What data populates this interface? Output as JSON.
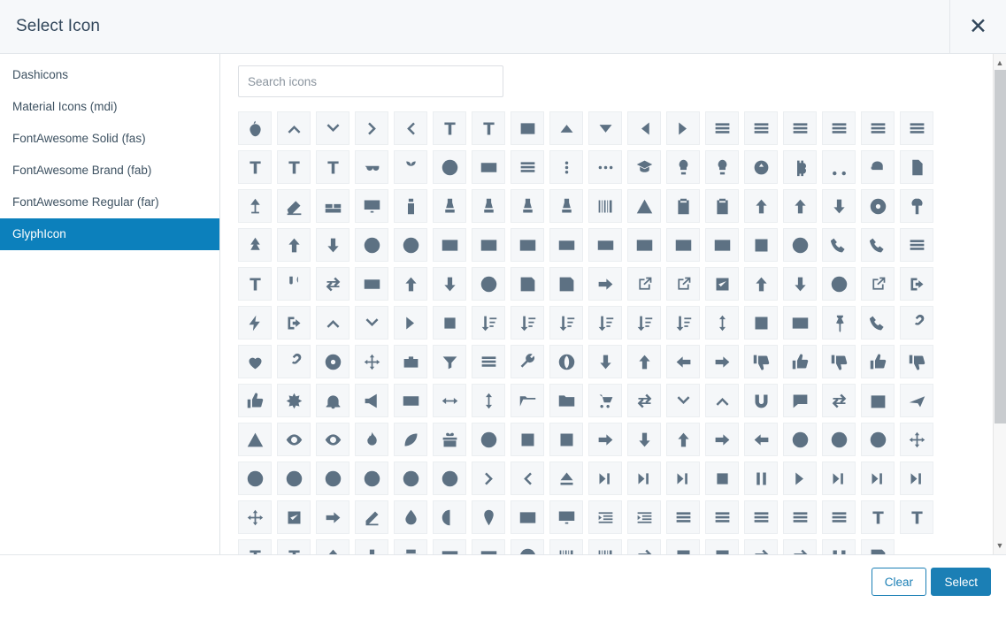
{
  "dialog": {
    "title": "Select Icon",
    "close_label": "✕"
  },
  "colors": {
    "accent": "#1b7fb5",
    "sidebar_active_bg": "#0c80bc",
    "header_bg": "#f6f8fa",
    "tile_bg": "#f5f7f9",
    "icon_fill": "#5d7183",
    "text": "#32475b"
  },
  "sidebar": {
    "items": [
      {
        "label": "Dashicons",
        "active": false
      },
      {
        "label": "Material Icons (mdi)",
        "active": false
      },
      {
        "label": "FontAwesome Solid (fas)",
        "active": false
      },
      {
        "label": "FontAwesome Brand (fab)",
        "active": false
      },
      {
        "label": "FontAwesome Regular (far)",
        "active": false
      },
      {
        "label": "GlyphIcon",
        "active": true
      }
    ]
  },
  "search": {
    "placeholder": "Search icons",
    "value": ""
  },
  "grid": {
    "columns": 18,
    "icons": [
      {
        "name": "apple-icon",
        "glyph": "🍎"
      },
      {
        "name": "chevron-up-icon",
        "glyph": "︿"
      },
      {
        "name": "chevron-down-icon",
        "glyph": "﹀"
      },
      {
        "name": "chevron-right-icon",
        "glyph": "›"
      },
      {
        "name": "chevron-left-icon",
        "glyph": "‹"
      },
      {
        "name": "subscript-icon",
        "glyph": "T₂"
      },
      {
        "name": "superscript-icon",
        "glyph": "T²"
      },
      {
        "name": "terminal-icon",
        "glyph": "≥_"
      },
      {
        "name": "triangle-up-icon",
        "glyph": "▲"
      },
      {
        "name": "triangle-down-icon",
        "glyph": "▼"
      },
      {
        "name": "triangle-left-icon",
        "glyph": "◀"
      },
      {
        "name": "triangle-right-icon",
        "glyph": "▶"
      },
      {
        "name": "align-object-left-icon",
        "glyph": "▣"
      },
      {
        "name": "align-object-center-icon",
        "glyph": "▣"
      },
      {
        "name": "align-object-vertical-icon",
        "glyph": "▣"
      },
      {
        "name": "align-object-right-icon",
        "glyph": "▣"
      },
      {
        "name": "align-object-bottom-icon",
        "glyph": "▣"
      },
      {
        "name": "align-object-top-icon",
        "glyph": "▣"
      },
      {
        "name": "font-boxed-icon",
        "glyph": "A"
      },
      {
        "name": "font-underline-icon",
        "glyph": "A"
      },
      {
        "name": "font-size-icon",
        "glyph": "T"
      },
      {
        "name": "glasses-icon",
        "glyph": "👓"
      },
      {
        "name": "seedling-icon",
        "glyph": "🌾"
      },
      {
        "name": "book-spine-icon",
        "glyph": "▤"
      },
      {
        "name": "window-icon",
        "glyph": "▣"
      },
      {
        "name": "menu-hamburger-icon",
        "glyph": "☰"
      },
      {
        "name": "dots-vertical-icon",
        "glyph": "⋮"
      },
      {
        "name": "dots-horizontal-icon",
        "glyph": "⋯"
      },
      {
        "name": "graduation-cap-icon",
        "glyph": "🎓"
      },
      {
        "name": "bulb-icon",
        "glyph": "💡"
      },
      {
        "name": "lollipop-icon",
        "glyph": "🍭"
      },
      {
        "name": "scale-icon",
        "glyph": "⚖"
      },
      {
        "name": "bitcoin-icon",
        "glyph": "₿"
      },
      {
        "name": "scissors-icon",
        "glyph": "✂"
      },
      {
        "name": "piggy-bank-icon",
        "glyph": "🐷"
      },
      {
        "name": "copy-files-icon",
        "glyph": "❐"
      },
      {
        "name": "lamp-icon",
        "glyph": "🛋"
      },
      {
        "name": "eraser-icon",
        "glyph": "◇"
      },
      {
        "name": "bed-icon",
        "glyph": "🛏"
      },
      {
        "name": "tv-icon",
        "glyph": "🖵"
      },
      {
        "name": "baby-bottle-icon",
        "glyph": "🍼"
      },
      {
        "name": "chess-knight-icon",
        "glyph": "♞"
      },
      {
        "name": "chess-bishop-icon",
        "glyph": "♝"
      },
      {
        "name": "chess-pawn-icon",
        "glyph": "♟"
      },
      {
        "name": "chess-queen-icon",
        "glyph": "♛"
      },
      {
        "name": "braille-icon",
        "glyph": "⠿"
      },
      {
        "name": "warning-triangle-icon",
        "glyph": "⚠"
      },
      {
        "name": "clipboard-out-icon",
        "glyph": "📋"
      },
      {
        "name": "clipboard-in-icon",
        "glyph": "📋"
      },
      {
        "name": "folder-upload-icon",
        "glyph": "📂"
      },
      {
        "name": "file-upload-icon",
        "glyph": "📄"
      },
      {
        "name": "file-download-icon",
        "glyph": "📄"
      },
      {
        "name": "disc-icon",
        "glyph": "💿"
      },
      {
        "name": "tree-deciduous-icon",
        "glyph": "🌳"
      },
      {
        "name": "tree-conifer-icon",
        "glyph": "🌲"
      },
      {
        "name": "cloud-upload-icon",
        "glyph": "☁"
      },
      {
        "name": "cloud-download-icon",
        "glyph": "☁"
      },
      {
        "name": "registered-icon",
        "glyph": "®"
      },
      {
        "name": "copyright-icon",
        "glyph": "©"
      },
      {
        "name": "seven-one-audio-icon",
        "glyph": "7.1"
      },
      {
        "name": "six-one-audio-icon",
        "glyph": "6.1"
      },
      {
        "name": "five-one-audio-icon",
        "glyph": "5.1"
      },
      {
        "name": "subtitles-icon",
        "glyph": "▭"
      },
      {
        "name": "widescreen-icon",
        "glyph": "▭"
      },
      {
        "name": "closed-caption-icon",
        "glyph": "CC"
      },
      {
        "name": "hd-video-icon",
        "glyph": "HD"
      },
      {
        "name": "sd-video-icon",
        "glyph": "SD"
      },
      {
        "name": "stats-bars-icon",
        "glyph": "▮"
      },
      {
        "name": "chess-rook-icon",
        "glyph": "♜"
      },
      {
        "name": "old-phone-icon",
        "glyph": "☎"
      },
      {
        "name": "phone-handset-icon",
        "glyph": "📞"
      },
      {
        "name": "database-transfer-icon",
        "glyph": "▤"
      },
      {
        "name": "header-icon",
        "glyph": "H"
      },
      {
        "name": "cutlery-icon",
        "glyph": "🍴"
      },
      {
        "name": "transfer-icon",
        "glyph": "⇄"
      },
      {
        "name": "credit-card-icon",
        "glyph": "▬"
      },
      {
        "name": "save-upload-icon",
        "glyph": "💾"
      },
      {
        "name": "save-download-icon",
        "glyph": "💾"
      },
      {
        "name": "save-remove-icon",
        "glyph": "💾"
      },
      {
        "name": "save-check-icon",
        "glyph": "💾"
      },
      {
        "name": "floppy-disk-icon",
        "glyph": "💾"
      },
      {
        "name": "send-icon",
        "glyph": "➤"
      },
      {
        "name": "export-icon",
        "glyph": "↗"
      },
      {
        "name": "import-icon",
        "glyph": "↙"
      },
      {
        "name": "check-in-icon",
        "glyph": "✔"
      },
      {
        "name": "upload-icon",
        "glyph": "⬆"
      },
      {
        "name": "download-icon",
        "glyph": "⬇"
      },
      {
        "name": "record-icon",
        "glyph": "◉"
      },
      {
        "name": "open-external-icon",
        "glyph": "↗"
      },
      {
        "name": "log-out-icon",
        "glyph": "⇥"
      },
      {
        "name": "flash-icon",
        "glyph": "⚡"
      },
      {
        "name": "log-in-icon",
        "glyph": "⇤"
      },
      {
        "name": "collapse-up-icon",
        "glyph": "▲"
      },
      {
        "name": "collapse-down-icon",
        "glyph": "▼"
      },
      {
        "name": "play-circle-icon",
        "glyph": "▶"
      },
      {
        "name": "stop-rounded-icon",
        "glyph": "◻"
      },
      {
        "name": "sort-by-attributes-icon",
        "glyph": "↓"
      },
      {
        "name": "sort-by-attributes-alt-icon",
        "glyph": "↓"
      },
      {
        "name": "sort-by-order-icon",
        "glyph": "↓1"
      },
      {
        "name": "sort-by-order-alt-icon",
        "glyph": "↓1"
      },
      {
        "name": "sort-by-alphabet-icon",
        "glyph": "↓A"
      },
      {
        "name": "sort-by-alphabet-alt-icon",
        "glyph": "↓A"
      },
      {
        "name": "sort-icon",
        "glyph": "↕"
      },
      {
        "name": "gbp-icon",
        "glyph": "£"
      },
      {
        "name": "usd-icon",
        "glyph": "$"
      },
      {
        "name": "pushpin-icon",
        "glyph": "📌"
      },
      {
        "name": "phone-icon",
        "glyph": "📱"
      },
      {
        "name": "link-icon",
        "glyph": "🔗"
      },
      {
        "name": "heart-empty-icon",
        "glyph": "♡"
      },
      {
        "name": "paperclip-icon",
        "glyph": "📎"
      },
      {
        "name": "dashboard-icon",
        "glyph": "◕"
      },
      {
        "name": "fullscreen-icon",
        "glyph": "⤢"
      },
      {
        "name": "briefcase-icon",
        "glyph": "💼"
      },
      {
        "name": "filter-icon",
        "glyph": "▽"
      },
      {
        "name": "server-icon",
        "glyph": "▤"
      },
      {
        "name": "wrench-icon",
        "glyph": "🔧"
      },
      {
        "name": "globe-icon",
        "glyph": "🌐"
      },
      {
        "name": "circle-arrow-down-icon",
        "glyph": "⬇"
      },
      {
        "name": "circle-arrow-up-icon",
        "glyph": "⬆"
      },
      {
        "name": "circle-arrow-left-icon",
        "glyph": "⬅"
      },
      {
        "name": "circle-arrow-right-icon",
        "glyph": "➡"
      },
      {
        "name": "thumbs-down-alt-icon",
        "glyph": "👎"
      },
      {
        "name": "thumbs-up-alt-icon",
        "glyph": "👍"
      },
      {
        "name": "thumbs-down-left-icon",
        "glyph": "👎"
      },
      {
        "name": "thumbs-up-left-icon",
        "glyph": "👍"
      },
      {
        "name": "thumbs-down-outline-icon",
        "glyph": "👎"
      },
      {
        "name": "thumbs-up-outline-icon",
        "glyph": "👍"
      },
      {
        "name": "sunburst-icon",
        "glyph": "✸"
      },
      {
        "name": "bell-icon",
        "glyph": "🔔"
      },
      {
        "name": "bullhorn-icon",
        "glyph": "📣"
      },
      {
        "name": "hard-drive-icon",
        "glyph": "▰"
      },
      {
        "name": "resize-horizontal-icon",
        "glyph": "↔"
      },
      {
        "name": "resize-vertical-icon",
        "glyph": "↕"
      },
      {
        "name": "folder-open-icon",
        "glyph": "📂"
      },
      {
        "name": "folder-close-icon",
        "glyph": "📁"
      },
      {
        "name": "shopping-cart-icon",
        "glyph": "🛒"
      },
      {
        "name": "duplicate-icon",
        "glyph": "⧉"
      },
      {
        "name": "chevron-down-bold-icon",
        "glyph": "⌄"
      },
      {
        "name": "chevron-up-bold-icon",
        "glyph": "⌃"
      },
      {
        "name": "magnet-icon",
        "glyph": "🧲"
      },
      {
        "name": "comment-icon",
        "glyph": "💬"
      },
      {
        "name": "random-icon",
        "glyph": "⤬"
      },
      {
        "name": "calendar-icon",
        "glyph": "📅"
      },
      {
        "name": "plane-icon",
        "glyph": "✈"
      },
      {
        "name": "alert-icon",
        "glyph": "⚠"
      },
      {
        "name": "eye-close-icon",
        "glyph": "👁"
      },
      {
        "name": "eye-open-icon",
        "glyph": "👁"
      },
      {
        "name": "fire-icon",
        "glyph": "🔥"
      },
      {
        "name": "leaf-icon",
        "glyph": "🍃"
      },
      {
        "name": "gift-icon",
        "glyph": "🎁"
      },
      {
        "name": "exclamation-sign-icon",
        "glyph": "❗"
      },
      {
        "name": "resize-small-icon",
        "glyph": "⤡"
      },
      {
        "name": "resize-full-icon",
        "glyph": "⤢"
      },
      {
        "name": "share-icon",
        "glyph": "↪"
      },
      {
        "name": "arrow-down-icon",
        "glyph": "⬇"
      },
      {
        "name": "arrow-up-icon",
        "glyph": "⬆"
      },
      {
        "name": "arrow-right-icon",
        "glyph": "➡"
      },
      {
        "name": "arrow-left-icon",
        "glyph": "⬅"
      },
      {
        "name": "ban-circle-icon",
        "glyph": "🚫"
      },
      {
        "name": "ok-circle-icon",
        "glyph": "✔"
      },
      {
        "name": "remove-circle-icon",
        "glyph": "✖"
      },
      {
        "name": "move-icon",
        "glyph": "✥"
      },
      {
        "name": "info-sign-icon",
        "glyph": "ℹ"
      },
      {
        "name": "question-sign-icon",
        "glyph": "?"
      },
      {
        "name": "ok-sign-icon",
        "glyph": "✔"
      },
      {
        "name": "remove-sign-icon",
        "glyph": "✖"
      },
      {
        "name": "minus-sign-icon",
        "glyph": "−"
      },
      {
        "name": "plus-sign-icon",
        "glyph": "+"
      },
      {
        "name": "chevron-right-bold-icon",
        "glyph": "❯"
      },
      {
        "name": "chevron-left-bold-icon",
        "glyph": "❮"
      },
      {
        "name": "eject-icon",
        "glyph": "⏏"
      },
      {
        "name": "step-forward-icon",
        "glyph": "⏭"
      },
      {
        "name": "fast-forward-icon",
        "glyph": "⏭"
      },
      {
        "name": "forward-icon",
        "glyph": "⏩"
      },
      {
        "name": "stop-icon",
        "glyph": "⏹"
      },
      {
        "name": "pause-icon",
        "glyph": "⏸"
      },
      {
        "name": "play-icon",
        "glyph": "▶"
      },
      {
        "name": "backward-icon",
        "glyph": "⏪"
      },
      {
        "name": "fast-backward-icon",
        "glyph": "⏮"
      },
      {
        "name": "step-backward-icon",
        "glyph": "⏮"
      },
      {
        "name": "fullscreen-move-icon",
        "glyph": "✥"
      },
      {
        "name": "check-box-icon",
        "glyph": "☑"
      },
      {
        "name": "share-alt-icon",
        "glyph": "↪"
      },
      {
        "name": "edit-icon",
        "glyph": "✎"
      },
      {
        "name": "tint-icon",
        "glyph": "💧"
      },
      {
        "name": "adjust-icon",
        "glyph": "◐"
      },
      {
        "name": "map-marker-icon",
        "glyph": "📍"
      },
      {
        "name": "picture-icon",
        "glyph": "🖼"
      },
      {
        "name": "facetime-video-icon",
        "glyph": "📹"
      },
      {
        "name": "indent-left-icon",
        "glyph": "⇤"
      },
      {
        "name": "indent-right-icon",
        "glyph": "⇥"
      },
      {
        "name": "list-icon",
        "glyph": "☰"
      },
      {
        "name": "align-justify-icon",
        "glyph": "≡"
      },
      {
        "name": "align-right-icon",
        "glyph": "≡"
      },
      {
        "name": "align-center-icon",
        "glyph": "≡"
      },
      {
        "name": "align-left-icon",
        "glyph": "≡"
      },
      {
        "name": "text-width-icon",
        "glyph": "T"
      },
      {
        "name": "text-height-icon",
        "glyph": "T"
      },
      {
        "name": "italic-icon",
        "glyph": "I"
      },
      {
        "name": "bold-icon",
        "glyph": "B"
      },
      {
        "name": "upload-alt-icon",
        "glyph": "⬆"
      },
      {
        "name": "download-alt-icon",
        "glyph": "⬇"
      },
      {
        "name": "print-icon",
        "glyph": "🖨"
      },
      {
        "name": "inbox-icon",
        "glyph": "📥"
      },
      {
        "name": "envelope-icon",
        "glyph": "✉"
      },
      {
        "name": "book-icon",
        "glyph": "📕"
      },
      {
        "name": "barcode-icon",
        "glyph": "▥"
      },
      {
        "name": "qrcode-icon",
        "glyph": "▦"
      },
      {
        "name": "transfer-alt-icon",
        "glyph": "⇄"
      },
      {
        "name": "arrow-thin-up-icon",
        "glyph": "↑"
      },
      {
        "name": "arrow-thin-down-icon",
        "glyph": "↓"
      },
      {
        "name": "refresh-icon",
        "glyph": "↻"
      },
      {
        "name": "retweet-icon",
        "glyph": "⇄"
      },
      {
        "name": "magnet-alt-icon",
        "glyph": "🧲"
      },
      {
        "name": "floppy-alt-icon",
        "glyph": "💾"
      }
    ]
  },
  "scrollbar": {
    "up_label": "▲",
    "down_label": "▼"
  },
  "footer": {
    "clear_label": "Clear",
    "select_label": "Select"
  }
}
